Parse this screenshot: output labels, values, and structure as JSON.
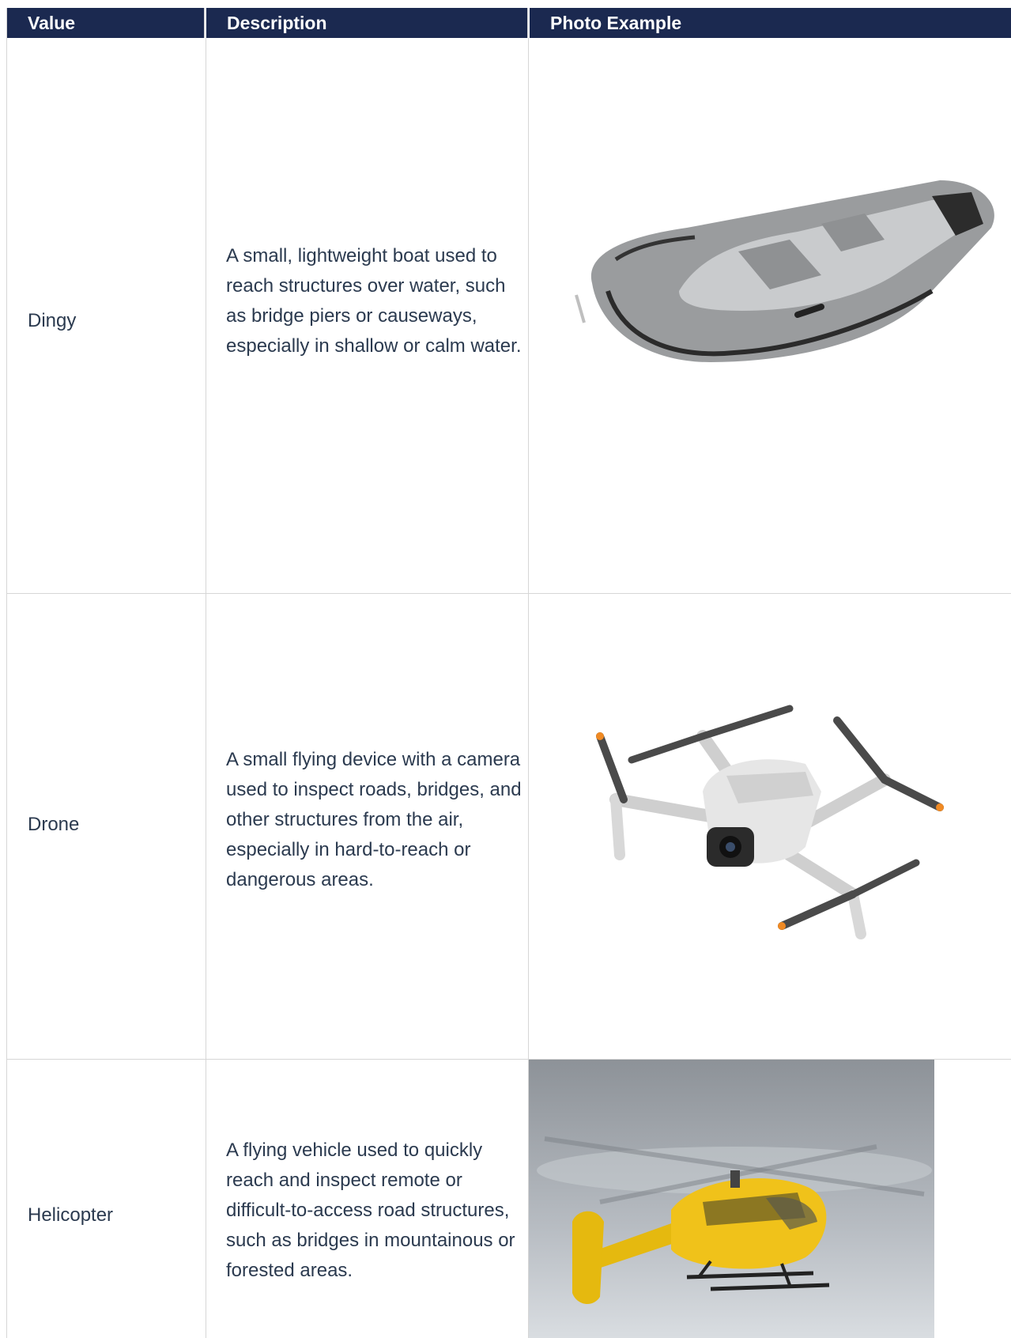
{
  "table": {
    "headers": {
      "value": "Value",
      "description": "Description",
      "photo": "Photo Example"
    },
    "rows": [
      {
        "value": "Dingy",
        "description": "A small, lightweight boat used to reach structures over water, such as bridge piers or causeways, especially in shallow or calm water.",
        "photo": "inflatable-dinghy-photo"
      },
      {
        "value": "Drone",
        "description": "A small flying device with a camera used to inspect roads, bridges, and other structures from the air, especially in hard-to-reach or dangerous areas.",
        "photo": "quadcopter-drone-photo"
      },
      {
        "value": "Helicopter",
        "description": "A flying vehicle used to quickly reach and inspect remote or difficult-to-access road structures, such as bridges in mountainous or forested areas.",
        "photo": "yellow-helicopter-photo"
      }
    ]
  },
  "colors": {
    "header_bg": "#1b2950",
    "header_text": "#ffffff",
    "body_text": "#2b3a4f",
    "grid": "#d6d6d6"
  }
}
